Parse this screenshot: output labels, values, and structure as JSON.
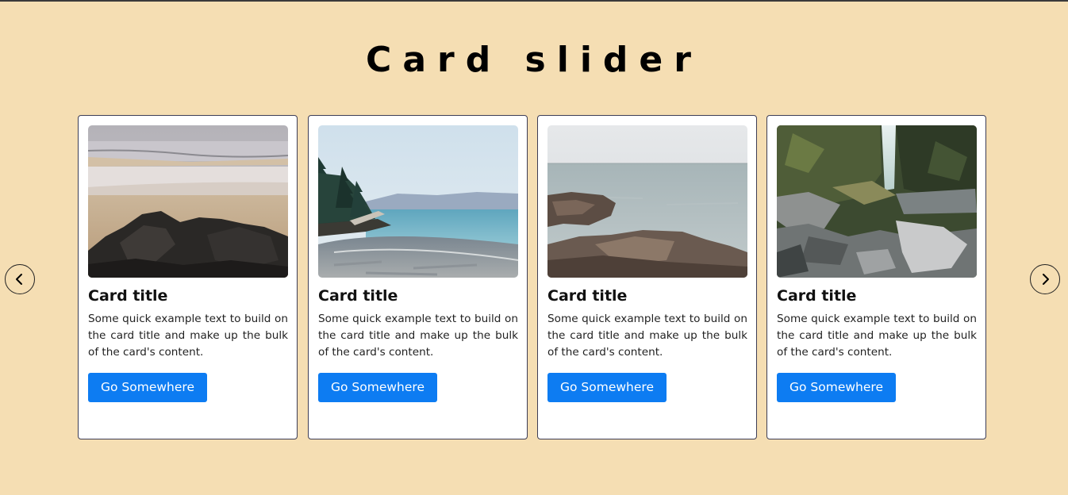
{
  "page": {
    "title": "Card slider"
  },
  "navigation": {
    "prev_icon": "chevron-left-icon",
    "next_icon": "chevron-right-icon"
  },
  "colors": {
    "background": "#f5deb3",
    "button": "#0d7cf2",
    "card_border": "#3d3d55"
  },
  "cards": [
    {
      "image": "beach-rocks-photo",
      "title": "Card title",
      "text": "Some quick example text to build on the card title and make up the bulk of the card's content.",
      "button_label": "Go Somewhere"
    },
    {
      "image": "forest-shoreline-photo",
      "title": "Card title",
      "text": "Some quick example text to build on the card title and make up the bulk of the card's content.",
      "button_label": "Go Somewhere"
    },
    {
      "image": "sea-rocks-photo",
      "title": "Card title",
      "text": "Some quick example text to build on the card title and make up the bulk of the card's content.",
      "button_label": "Go Somewhere"
    },
    {
      "image": "waterfall-canyon-photo",
      "title": "Card title",
      "text": "Some quick example text to build on the card title and make up the bulk of the card's content.",
      "button_label": "Go Somewhere"
    }
  ]
}
